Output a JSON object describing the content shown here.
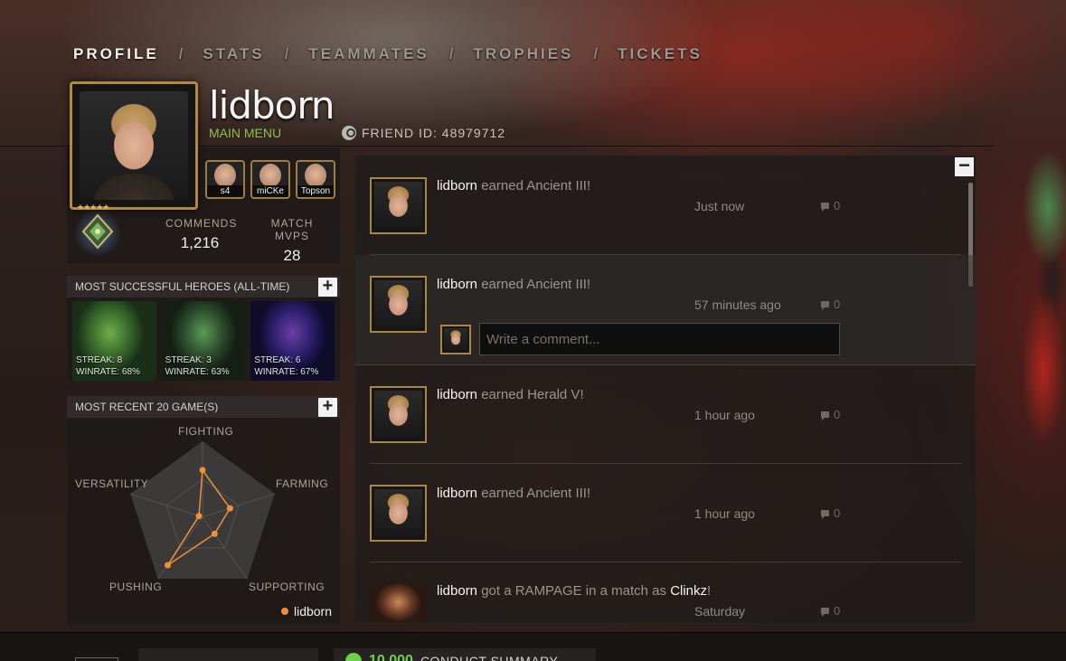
{
  "nav": {
    "tabs": [
      "PROFILE",
      "STATS",
      "TEAMMATES",
      "TROPHIES",
      "TICKETS"
    ],
    "separator": "/"
  },
  "profile": {
    "username": "lidborn",
    "main_menu": "MAIN MENU",
    "friend_id": "FRIEND ID: 48979712",
    "friends": [
      "s4",
      "miCKe",
      "Topson"
    ],
    "stats": {
      "commends_label": "COMMENDS",
      "commends_value": "1,216",
      "mvps_label": "MATCH MVPS",
      "mvps_value": "28"
    }
  },
  "heroes_section": {
    "title": "MOST SUCCESSFUL HEROES (ALL-TIME)",
    "plus": "+",
    "heroes": [
      {
        "streak": "STREAK: 8",
        "winrate": "WINRATE: 68%"
      },
      {
        "streak": "STREAK: 3",
        "winrate": "WINRATE: 63%"
      },
      {
        "streak": "STREAK: 6",
        "winrate": "WINRATE: 67%"
      }
    ]
  },
  "recent_section": {
    "title": "MOST RECENT 20 GAME(S)",
    "plus": "+",
    "axes": [
      "FIGHTING",
      "FARMING",
      "SUPPORTING",
      "PUSHING",
      "VERSATILITY"
    ],
    "legend": "lidborn",
    "accent": "#ef8f3a"
  },
  "chart_data": {
    "type": "radar",
    "axes": [
      "FIGHTING",
      "FARMING",
      "SUPPORTING",
      "PUSHING",
      "VERSATILITY"
    ],
    "series": [
      {
        "name": "lidborn",
        "values": [
          0.62,
          0.38,
          0.27,
          0.78,
          0.05
        ]
      }
    ],
    "range": [
      0,
      1
    ]
  },
  "feed": {
    "collapse": "−",
    "items": [
      {
        "user": "lidborn",
        "action": " earned ",
        "object": "Ancient III!",
        "tail": "",
        "time": "Just now",
        "comments": "0"
      },
      {
        "user": "lidborn",
        "action": " earned ",
        "object": "Ancient III!",
        "tail": "",
        "time": "57 minutes ago",
        "comments": "0"
      },
      {
        "user": "lidborn",
        "action": " earned ",
        "object": "Herald V!",
        "tail": "",
        "time": "1 hour ago",
        "comments": "0"
      },
      {
        "user": "lidborn",
        "action": " earned ",
        "object": "Ancient III!",
        "tail": "",
        "time": "1 hour ago",
        "comments": "0"
      },
      {
        "user": "lidborn",
        "action": " got a RAMPAGE in a match as ",
        "object": "Clinkz",
        "tail": "!",
        "time": "Saturday",
        "comments": "0"
      }
    ],
    "comment_placeholder": "Write a comment..."
  },
  "bottom": {
    "conduct_score": "10,000",
    "conduct_label": "CONDUCT SUMMARY"
  }
}
